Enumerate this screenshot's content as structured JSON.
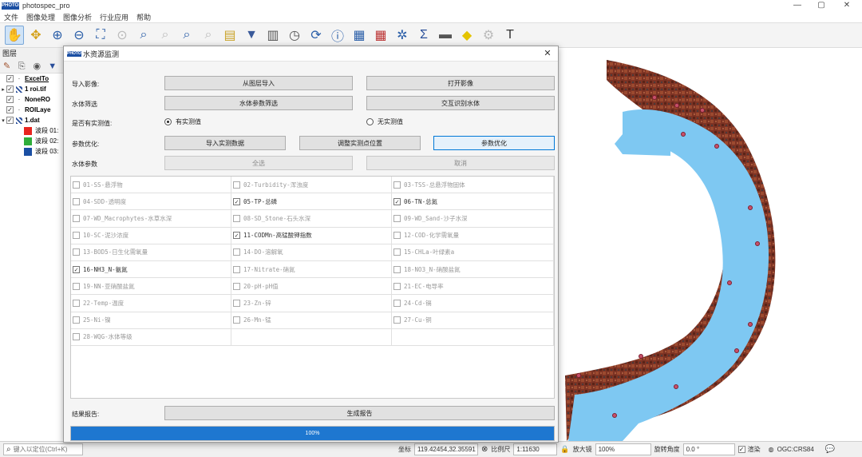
{
  "app": {
    "title": "photospec_pro",
    "logo_text": "PHOTOSPEC"
  },
  "menu": [
    "文件",
    "图像处理",
    "图像分析",
    "行业应用",
    "帮助"
  ],
  "layers_panel": {
    "title": "图层",
    "items": [
      {
        "label": "ExcelTo",
        "type": "dot",
        "expand": ""
      },
      {
        "label": "1 roi.tif",
        "type": "grid",
        "expand": "▸"
      },
      {
        "label": "NoneRO",
        "type": "dot",
        "expand": ""
      },
      {
        "label": "ROILaye",
        "type": "dot",
        "expand": ""
      },
      {
        "label": "1.dat",
        "type": "grid",
        "expand": "▾"
      }
    ],
    "bands": [
      {
        "label": "波段 01:",
        "color": "#e8251f"
      },
      {
        "label": "波段 02:",
        "color": "#2fae3a"
      },
      {
        "label": "波段 03:",
        "color": "#1b4fa3"
      }
    ]
  },
  "dialog": {
    "title": "水资源监测",
    "import_label": "导入影像:",
    "btn_from_layer": "从图层导入",
    "btn_open_image": "打开影像",
    "filter_label": "水体筛选",
    "btn_param_filter": "水体参数筛选",
    "btn_interactive": "交互识别水体",
    "measured_label": "是否有实测值:",
    "radio_yes": "有实测值",
    "radio_no": "无实测值",
    "optimize_label": "参数优化:",
    "btn_import_measured": "导入实测数据",
    "btn_adjust_points": "调整实测点位置",
    "btn_optimize": "参数优化",
    "water_params_label": "水体参数",
    "btn_select_all": "全选",
    "btn_cancel": "取消",
    "params": [
      {
        "label": "01-SS-悬浮物",
        "checked": false
      },
      {
        "label": "02-Turbidity-浑浊度",
        "checked": false
      },
      {
        "label": "03-TSS-总悬浮物固体",
        "checked": false
      },
      {
        "label": "04-SDD-透明度",
        "checked": false
      },
      {
        "label": "05-TP-总磷",
        "checked": true
      },
      {
        "label": "06-TN-总氮",
        "checked": true
      },
      {
        "label": "07-WD_Macrophytes-水草水深",
        "checked": false
      },
      {
        "label": "08-SD_Stone-石头水深",
        "checked": false
      },
      {
        "label": "09-WD_Sand-沙子水深",
        "checked": false
      },
      {
        "label": "10-SC-泥沙浓度",
        "checked": false
      },
      {
        "label": "11-CODMn-高锰酸钾指数",
        "checked": true
      },
      {
        "label": "12-COD-化学需氧量",
        "checked": false
      },
      {
        "label": "13-BOD5-日生化需氧量",
        "checked": false
      },
      {
        "label": "14-DO-溶解氧",
        "checked": false
      },
      {
        "label": "15-CHLa-叶绿素a",
        "checked": false
      },
      {
        "label": "16-NH3_N-氨氮",
        "checked": true
      },
      {
        "label": "17-Nitrate-硝氮",
        "checked": false
      },
      {
        "label": "18-NO3_N-硝酸盐氮",
        "checked": false
      },
      {
        "label": "19-NN-亚硝酸盐氮",
        "checked": false
      },
      {
        "label": "20-pH-pH值",
        "checked": false
      },
      {
        "label": "21-EC-电导率",
        "checked": false
      },
      {
        "label": "22-Temp-温度",
        "checked": false
      },
      {
        "label": "23-Zn-锌",
        "checked": false
      },
      {
        "label": "24-Cd-镉",
        "checked": false
      },
      {
        "label": "25-Ni-镍",
        "checked": false
      },
      {
        "label": "26-Mn-锰",
        "checked": false
      },
      {
        "label": "27-Cu-铜",
        "checked": false
      },
      {
        "label": "28-WQG-水体等级",
        "checked": false
      }
    ],
    "report_label": "结果报告:",
    "btn_generate_report": "生成报告",
    "progress_text": "100%",
    "progress_value": 1.0
  },
  "statusbar": {
    "locator_placeholder": "键入以定位(Ctrl+K)",
    "coord_label": "坐标",
    "coord_value": "119.42454,32.35591",
    "scale_label": "比例尺",
    "scale_value": "1:11630",
    "magnifier_label": "放大镜",
    "magnifier_value": "100%",
    "rotation_label": "旋转角度",
    "rotation_value": "0.0 °",
    "render_label": "渲染",
    "crs_value": "OGC:CRS84"
  },
  "colors": {
    "accent": "#1e77d0",
    "water": "#7ec8f2",
    "land": "#8a3a2a"
  }
}
